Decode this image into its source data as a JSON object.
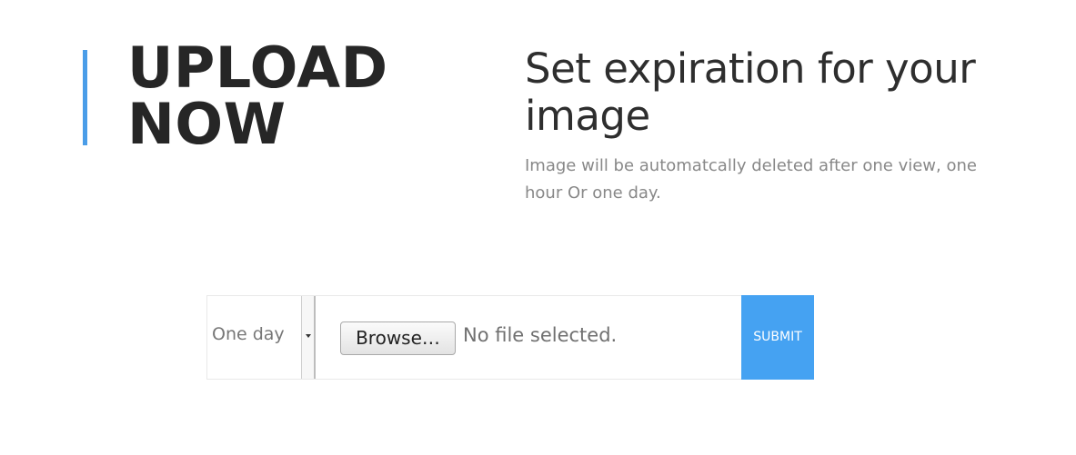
{
  "hero": {
    "title_line1": "UPLOAD",
    "title_line2": "NOW"
  },
  "expiration": {
    "heading": "Set expiration for your image",
    "description": "Image will be automatcally deleted after one view, one hour Or one day."
  },
  "form": {
    "expire_select": {
      "selected": "One day"
    },
    "browse_label": "Browse…",
    "file_status": "No file selected.",
    "submit_label": "SUBMIT"
  },
  "colors": {
    "accent": "#4a9de8",
    "submit_bg": "#45a2f2"
  }
}
